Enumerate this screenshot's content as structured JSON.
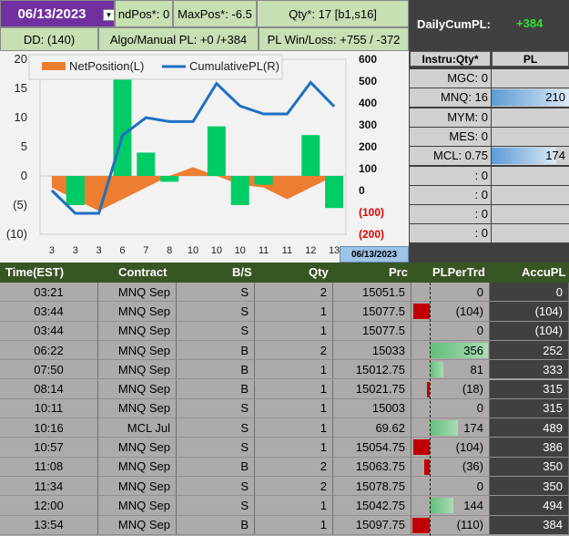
{
  "header": {
    "date": "06/13/2023",
    "end_pos": "ndPos*: 0",
    "max_pos": "MaxPos*: -6.5",
    "qty": "Qty*: 17 [b1,s16]",
    "dd": "DD: (140)",
    "algo_manual_pl": "Algo/Manual PL: +0 /+384",
    "pl_win_loss": "PL Win/Loss: +755 / -372",
    "daily_label": "DailyCumPL:",
    "daily_value": "+384"
  },
  "colors": {
    "date_bg": "#7030a0",
    "green_header": "#c6e0b4",
    "dark_panel": "#404040",
    "table_header": "#375623",
    "net_bar_pos": "#00cc66",
    "net_area": "#ed7d31",
    "cum_line": "#1f6fc1",
    "pos_bar": "#5fd07a",
    "neg_bar": "#c00000"
  },
  "chart_data": {
    "type": "bar",
    "legend_position": "top",
    "series": [
      {
        "name": "NetPosition(L)",
        "axis": "left"
      },
      {
        "name": "CumulativePL(R)",
        "axis": "right"
      }
    ],
    "x": [
      "3",
      "3",
      "3",
      "6",
      "7",
      "8",
      "10",
      "10",
      "10",
      "11",
      "11",
      "12",
      "13"
    ],
    "left_axis": {
      "ticks": [
        "20",
        "15",
        "10",
        "5",
        "0",
        "(5)",
        "(10)"
      ],
      "min": -10,
      "max": 20
    },
    "right_axis": {
      "ticks": [
        "600",
        "500",
        "400",
        "300",
        "200",
        "100",
        "0",
        "(100)",
        "(200)"
      ],
      "min": -200,
      "max": 600
    },
    "net_position_area": [
      -2,
      -4,
      -6,
      -4,
      -2,
      0,
      1.5,
      0,
      -1.5,
      -2,
      -4,
      -2,
      0
    ],
    "trade_bars": [
      0,
      -5,
      0,
      17,
      4,
      -1,
      0,
      8.5,
      -5,
      -1.5,
      0,
      7,
      -5.5
    ],
    "cumulative_pl": [
      0,
      -104,
      -104,
      252,
      333,
      315,
      315,
      489,
      386,
      350,
      350,
      494,
      384
    ],
    "date_tag": "06/13/2023"
  },
  "instruments": {
    "head_qty": "Instru:Qty*",
    "head_pl": "PL",
    "rows": [
      {
        "qty": "MGC: 0",
        "pl": "",
        "bar": 0
      },
      {
        "qty": "MNQ: 16",
        "pl": "210",
        "bar": 1.0
      },
      {
        "qty": "MYM: 0",
        "pl": "",
        "bar": 0
      },
      {
        "qty": "MES: 0",
        "pl": "",
        "bar": 0
      },
      {
        "qty": "MCL: 0.75",
        "pl": "174",
        "bar": 0.83
      },
      {
        "qty": ": 0",
        "pl": "",
        "bar": 0
      },
      {
        "qty": ": 0",
        "pl": "",
        "bar": 0
      },
      {
        "qty": ": 0",
        "pl": "",
        "bar": 0
      },
      {
        "qty": ": 0",
        "pl": "",
        "bar": 0
      }
    ]
  },
  "table": {
    "headers": [
      "Time(EST)",
      "Contract",
      "B/S",
      "Qty",
      "Prc",
      "PLPerTrd",
      "AccuPL"
    ],
    "rows": [
      {
        "time": "03:21",
        "contract": "MNQ Sep",
        "bs": "S",
        "qty": "2",
        "prc": "15051.5",
        "pl": "0",
        "pl_num": 0,
        "accu": "0"
      },
      {
        "time": "03:44",
        "contract": "MNQ Sep",
        "bs": "S",
        "qty": "1",
        "prc": "15077.5",
        "pl": "(104)",
        "pl_num": -104,
        "accu": "(104)"
      },
      {
        "time": "03:44",
        "contract": "MNQ Sep",
        "bs": "S",
        "qty": "1",
        "prc": "15077.5",
        "pl": "0",
        "pl_num": 0,
        "accu": "(104)"
      },
      {
        "time": "06:22",
        "contract": "MNQ Sep",
        "bs": "B",
        "qty": "2",
        "prc": "15033",
        "pl": "356",
        "pl_num": 356,
        "accu": "252"
      },
      {
        "time": "07:50",
        "contract": "MNQ Sep",
        "bs": "B",
        "qty": "1",
        "prc": "15012.75",
        "pl": "81",
        "pl_num": 81,
        "accu": "333"
      },
      {
        "time": "08:14",
        "contract": "MNQ Sep",
        "bs": "B",
        "qty": "1",
        "prc": "15021.75",
        "pl": "(18)",
        "pl_num": -18,
        "accu": "315"
      },
      {
        "time": "10:11",
        "contract": "MNQ Sep",
        "bs": "S",
        "qty": "1",
        "prc": "15003",
        "pl": "0",
        "pl_num": 0,
        "accu": "315"
      },
      {
        "time": "10:16",
        "contract": "MCL Jul",
        "bs": "S",
        "qty": "1",
        "prc": "69.62",
        "pl": "174",
        "pl_num": 174,
        "accu": "489"
      },
      {
        "time": "10:57",
        "contract": "MNQ Sep",
        "bs": "S",
        "qty": "1",
        "prc": "15054.75",
        "pl": "(104)",
        "pl_num": -104,
        "accu": "386"
      },
      {
        "time": "11:08",
        "contract": "MNQ Sep",
        "bs": "B",
        "qty": "2",
        "prc": "15063.75",
        "pl": "(36)",
        "pl_num": -36,
        "accu": "350"
      },
      {
        "time": "11:34",
        "contract": "MNQ Sep",
        "bs": "S",
        "qty": "2",
        "prc": "15078.75",
        "pl": "0",
        "pl_num": 0,
        "accu": "350"
      },
      {
        "time": "12:00",
        "contract": "MNQ Sep",
        "bs": "S",
        "qty": "1",
        "prc": "15042.75",
        "pl": "144",
        "pl_num": 144,
        "accu": "494"
      },
      {
        "time": "13:54",
        "contract": "MNQ Sep",
        "bs": "B",
        "qty": "1",
        "prc": "15097.75",
        "pl": "(110)",
        "pl_num": -110,
        "accu": "384"
      }
    ]
  }
}
